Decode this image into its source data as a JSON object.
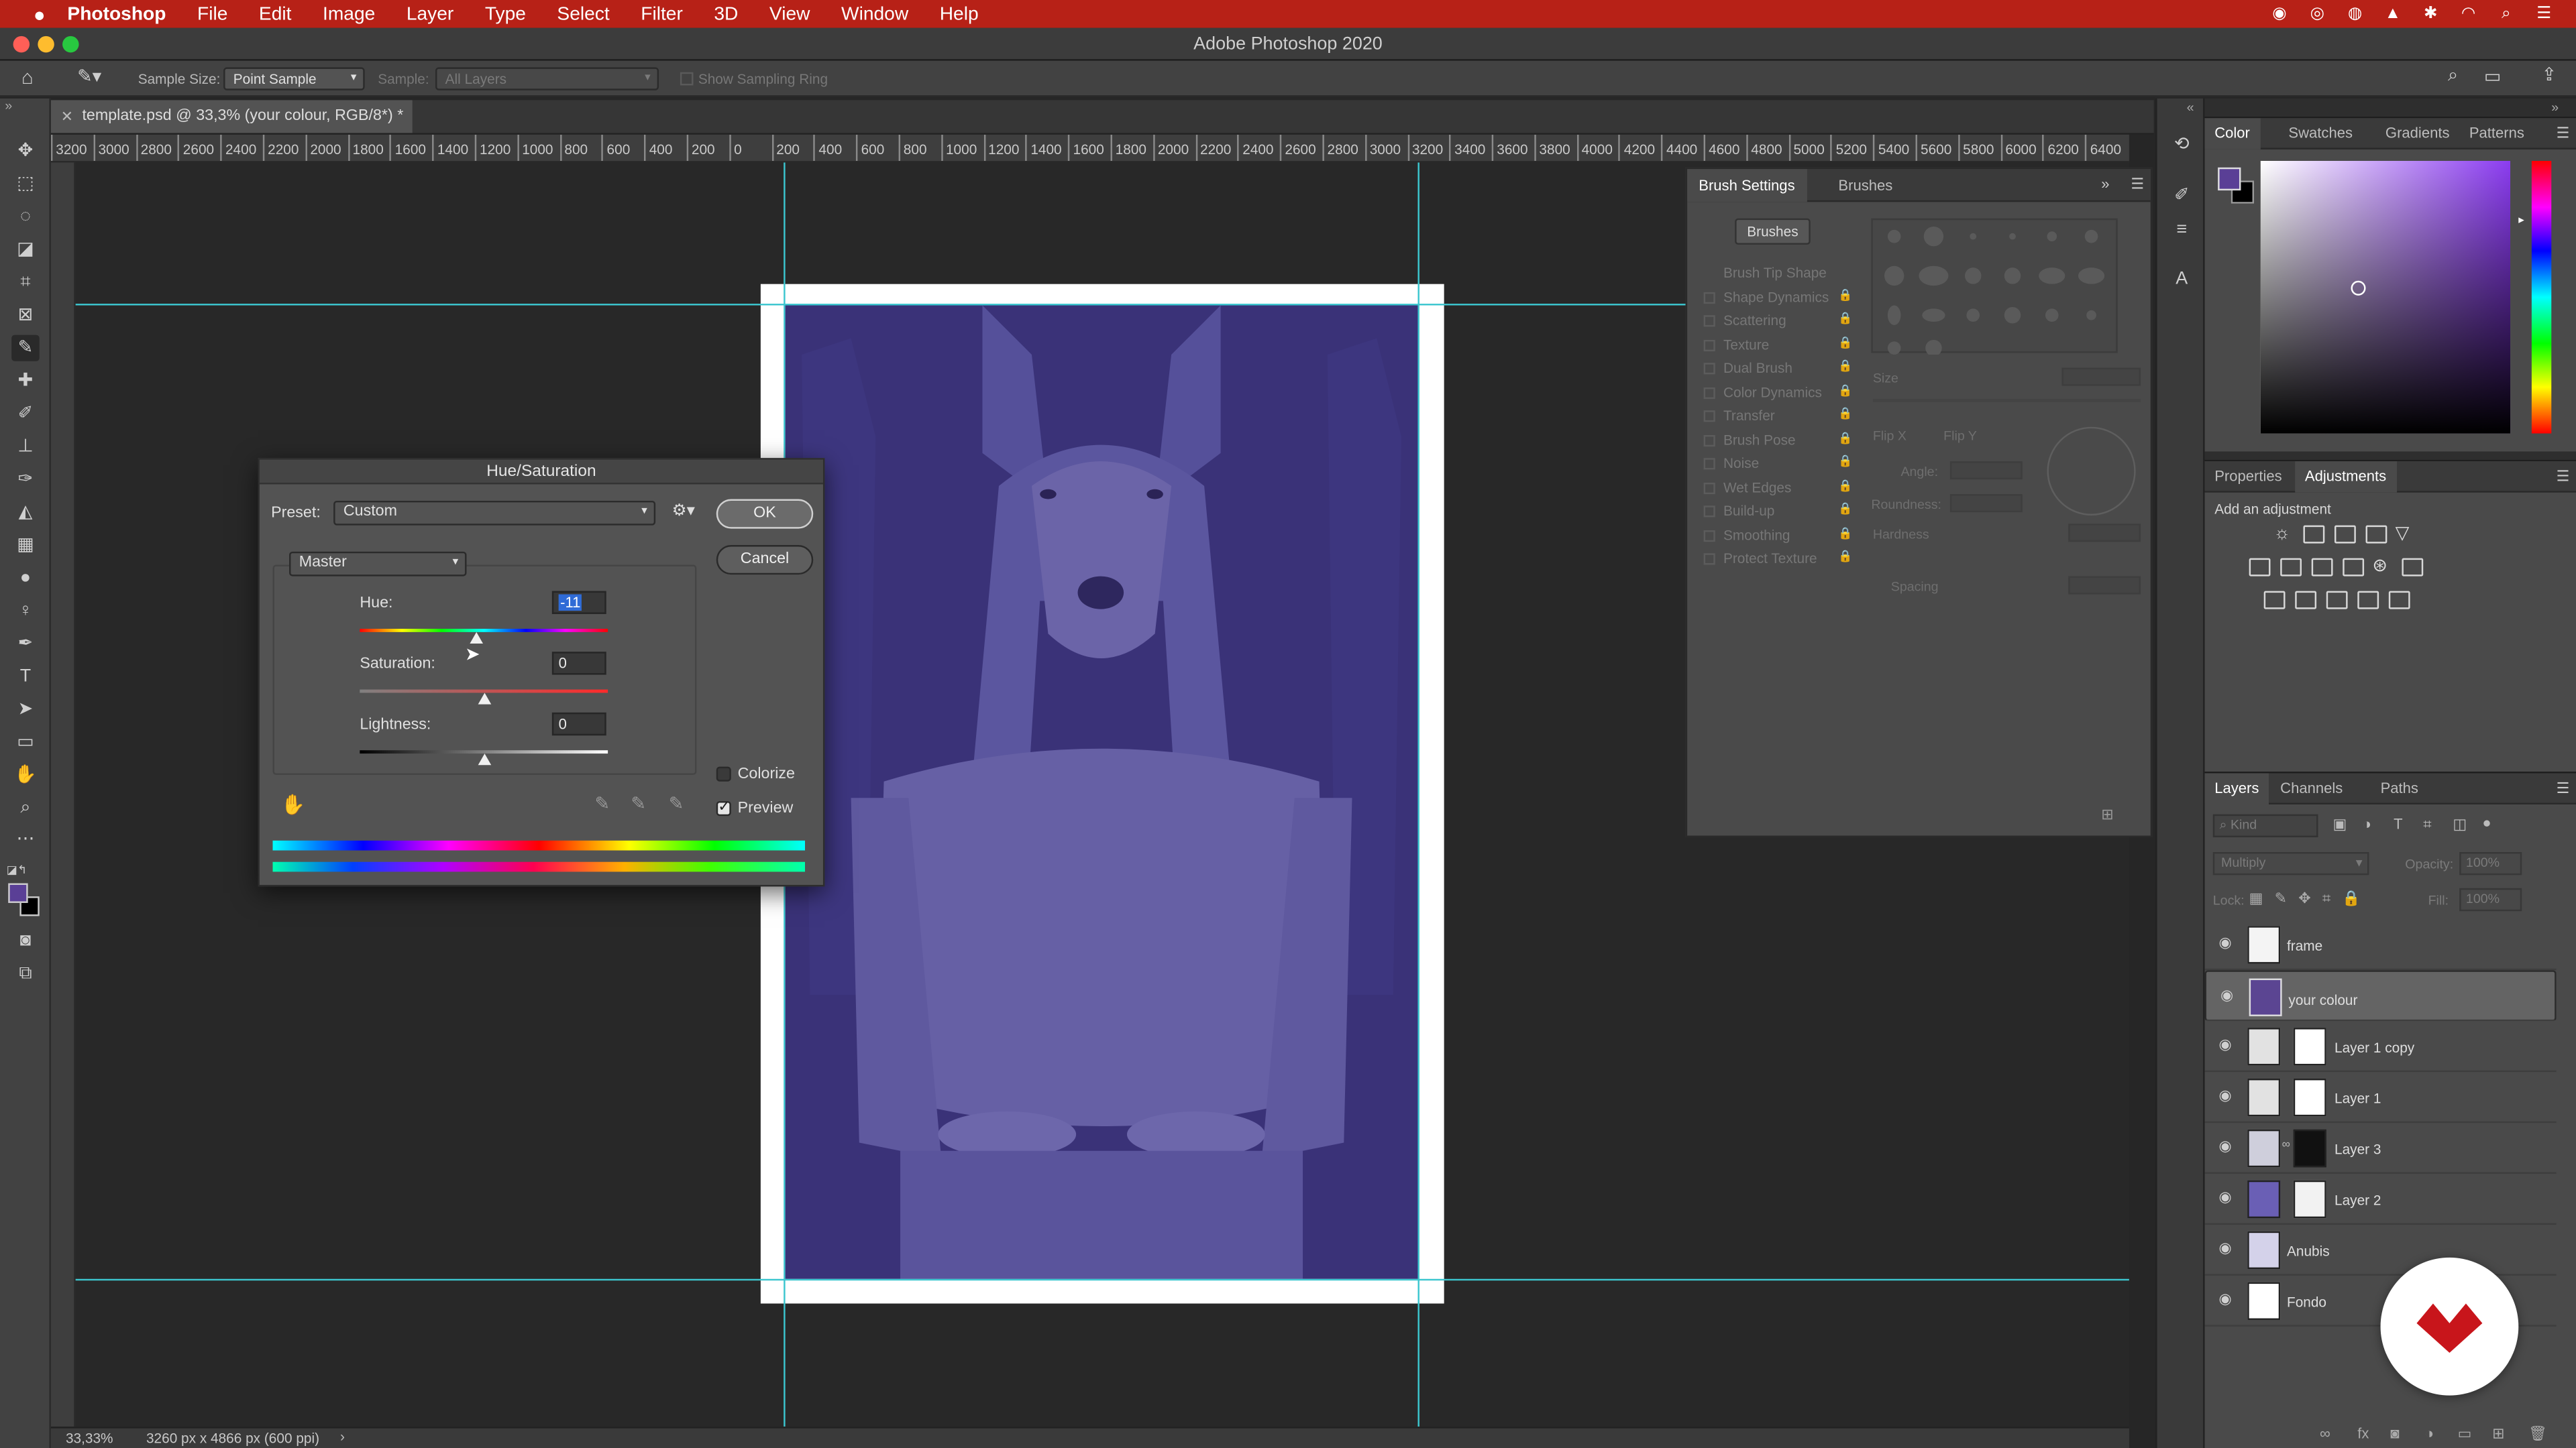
{
  "menubar": {
    "app": "Photoshop",
    "items": [
      "File",
      "Edit",
      "Image",
      "Layer",
      "Type",
      "Select",
      "Filter",
      "3D",
      "View",
      "Window",
      "Help"
    ]
  },
  "window": {
    "title": "Adobe Photoshop 2020"
  },
  "options_bar": {
    "sample_size_label": "Sample Size:",
    "sample_size_value": "Point Sample",
    "sample_label": "Sample:",
    "sample_value": "All Layers",
    "show_ring_label": "Show Sampling Ring"
  },
  "document": {
    "tab_title": "template.psd @ 33,3% (your colour, RGB/8*) *",
    "ruler_labels": [
      "3200",
      "3000",
      "2800",
      "2600",
      "2400",
      "2200",
      "2000",
      "1800",
      "1600",
      "1400",
      "1200",
      "1000",
      "800",
      "600",
      "400",
      "200",
      "0",
      "200",
      "400",
      "600",
      "800",
      "1000",
      "1200",
      "1400",
      "1600",
      "1800",
      "2000",
      "2200",
      "2400",
      "2600",
      "2800",
      "3000",
      "3200",
      "3400",
      "3600",
      "3800",
      "4000",
      "4200",
      "4400",
      "4600",
      "4800",
      "5000",
      "5200",
      "5400",
      "5600",
      "5800",
      "6000",
      "6200",
      "6400"
    ]
  },
  "status": {
    "zoom": "33,33%",
    "doc_info": "3260 px x 4866 px (600 ppi)"
  },
  "brush_panel": {
    "tabs": [
      "Brush Settings",
      "Brushes"
    ],
    "brushes_button": "Brushes",
    "items": [
      "Brush Tip Shape",
      "Shape Dynamics",
      "Scattering",
      "Texture",
      "Dual Brush",
      "Color Dynamics",
      "Transfer",
      "Brush Pose",
      "Noise",
      "Wet Edges",
      "Build-up",
      "Smoothing",
      "Protect Texture"
    ],
    "size_label": "Size",
    "flip_x": "Flip X",
    "flip_y": "Flip Y",
    "angle_label": "Angle:",
    "roundness_label": "Roundness:",
    "hardness_label": "Hardness",
    "spacing_label": "Spacing"
  },
  "color_panel": {
    "tabs": [
      "Color",
      "Swatches",
      "Gradients",
      "Patterns"
    ],
    "foreground": "#5a3f96",
    "field_hue": "#8b3cf0"
  },
  "adjustments_panel": {
    "tabs": [
      "Properties",
      "Adjustments"
    ],
    "subtitle": "Add an adjustment"
  },
  "layers_panel": {
    "tabs": [
      "Layers",
      "Channels",
      "Paths"
    ],
    "kind_placeholder": "Kind",
    "blend_mode": "Multiply",
    "opacity_label": "Opacity:",
    "opacity_value": "100%",
    "lock_label": "Lock:",
    "fill_label": "Fill:",
    "fill_value": "100%",
    "layers": [
      {
        "name": "frame"
      },
      {
        "name": "your colour",
        "selected": true
      },
      {
        "name": "Layer 1 copy"
      },
      {
        "name": "Layer 1"
      },
      {
        "name": "Layer 3"
      },
      {
        "name": "Layer 2"
      },
      {
        "name": "Anubis"
      },
      {
        "name": "Fondo"
      }
    ]
  },
  "dialog": {
    "title": "Hue/Saturation",
    "preset_label": "Preset:",
    "preset_value": "Custom",
    "channel_value": "Master",
    "ok": "OK",
    "cancel": "Cancel",
    "hue_label": "Hue:",
    "hue_value": "-11",
    "saturation_label": "Saturation:",
    "saturation_value": "0",
    "lightness_label": "Lightness:",
    "lightness_value": "0",
    "colorize_label": "Colorize",
    "colorize_checked": false,
    "preview_label": "Preview",
    "preview_checked": true
  },
  "colors": {
    "menubar": "#b72117",
    "guide": "#3cc6cf",
    "artwork": "#3d3580"
  }
}
